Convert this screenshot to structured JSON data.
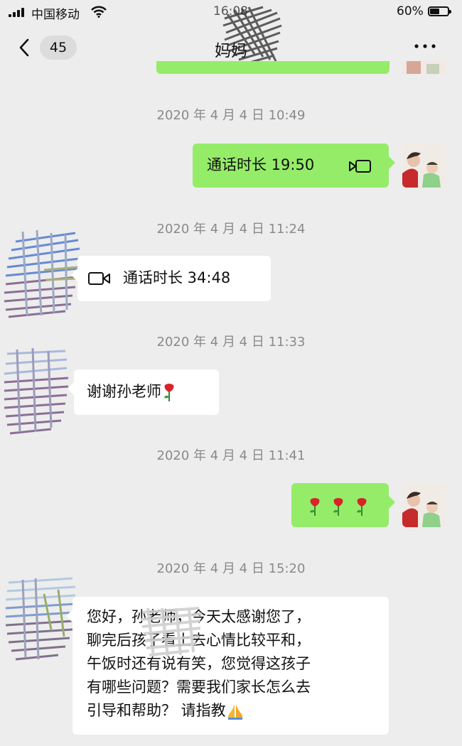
{
  "status_bar": {
    "carrier": "中国移动",
    "time": "16:08",
    "battery_percent": "60%",
    "battery_level": 0.6
  },
  "nav": {
    "unread_count": "45",
    "title": "妈妈"
  },
  "icons": {
    "back": "chevron-left-icon",
    "more": "more-dots-icon",
    "video_call": "video-call-icon",
    "rose": "rose-emoji",
    "praying_hands": "praying-hands-emoji"
  },
  "colors": {
    "background": "#ededed",
    "sent_bubble": "#95ec69",
    "received_bubble": "#ffffff",
    "timestamp": "#8a8a8a"
  },
  "messages": [
    {
      "timestamp": "2020 年 4 月 4 日  10:49",
      "sender": "me",
      "text": "通话时长 19:50"
    },
    {
      "timestamp": "2020 年 4 月 4 日  11:24",
      "sender": "contact",
      "text": "通话时长 34:48"
    },
    {
      "timestamp": "2020 年 4 月 4 日  11:33",
      "sender": "contact",
      "text": "谢谢孙老师"
    },
    {
      "timestamp": "2020 年 4 月 4 日  11:41",
      "sender": "me",
      "text": ""
    },
    {
      "timestamp": "2020 年 4 月 4 日  15:20",
      "sender": "contact",
      "lines": [
        "您好，孙老师，今天太感谢您了，",
        "聊完后孩子看上去心情比较平和，",
        "午饭时还有说有笑，您觉得这孩子",
        "有哪些问题？需要我们家长怎么去",
        "引导和帮助？ 请指教"
      ]
    }
  ]
}
